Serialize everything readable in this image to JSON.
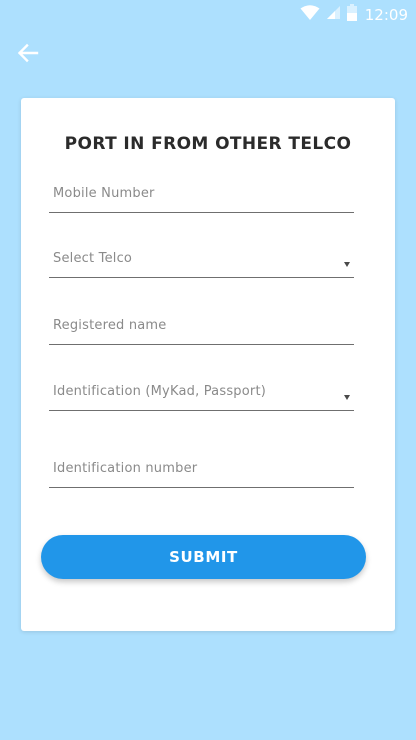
{
  "status_bar": {
    "time": "12:09",
    "icons": [
      "wifi-icon",
      "cell-signal-icon",
      "battery-icon"
    ]
  },
  "header": {
    "back_icon": "arrow-left-icon"
  },
  "form": {
    "title": "PORT IN FROM OTHER TELCO",
    "fields": {
      "mobile_number": {
        "placeholder": "Mobile Number",
        "type": "text"
      },
      "telco": {
        "placeholder": "Select Telco",
        "type": "select"
      },
      "registered_name": {
        "placeholder": "Registered name",
        "type": "text"
      },
      "identification_type": {
        "placeholder": "Identification (MyKad, Passport)",
        "type": "select"
      },
      "identification_number": {
        "placeholder": "Identification number",
        "type": "text"
      }
    },
    "submit_label": "SUBMIT"
  },
  "colors": {
    "background": "#ade0fe",
    "card": "#ffffff",
    "accent": "#2196e9",
    "title_text": "#2b2b2b",
    "placeholder_text": "#8a8a8a",
    "underline": "#6f6f6f"
  }
}
